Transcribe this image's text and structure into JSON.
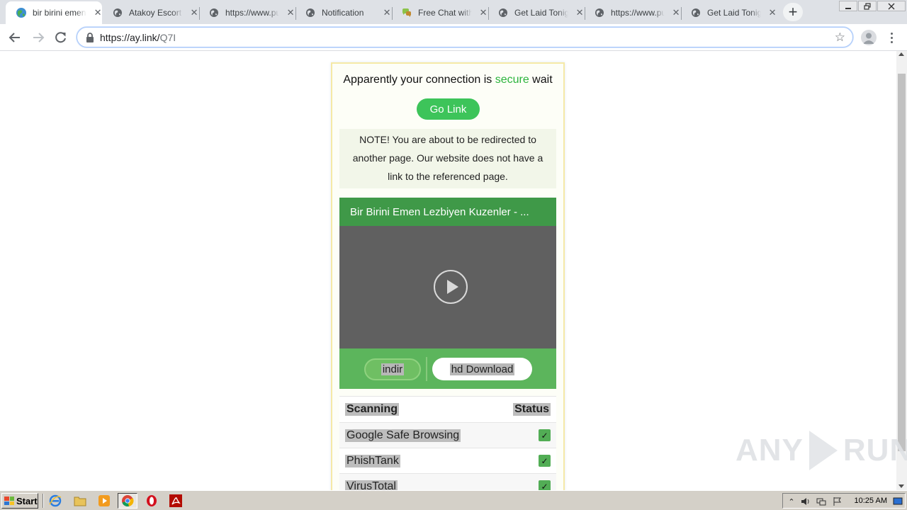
{
  "browser": {
    "tabs": [
      {
        "title": "bir birini emen lezbiyen kuzenler",
        "active": true,
        "icon": "globe-green-icon"
      },
      {
        "title": "Atakoy Escort",
        "active": false,
        "icon": "globe-icon"
      },
      {
        "title": "https://www.pu",
        "active": false,
        "icon": "globe-icon"
      },
      {
        "title": "Notification",
        "active": false,
        "icon": "globe-icon"
      },
      {
        "title": "Free Chat with",
        "active": false,
        "icon": "chat-icon"
      },
      {
        "title": "Get Laid Tonight",
        "active": false,
        "icon": "globe-icon"
      },
      {
        "title": "https://www.pu",
        "active": false,
        "icon": "globe-icon"
      },
      {
        "title": "Get Laid Tonight",
        "active": false,
        "icon": "globe-icon"
      }
    ],
    "tab_close_glyph": "✕",
    "new_tab_glyph": "+",
    "url_host": "https://ay.link/",
    "url_path": "Q7I"
  },
  "page": {
    "connection_prefix": "Apparently your connection is ",
    "connection_secure": "secure",
    "connection_suffix": " wait",
    "go_link_label": "Go Link",
    "note": "NOTE! You are about to be redirected to another page. Our website does not have a link to the referenced page.",
    "video_title": "Bir Birini Emen Lezbiyen Kuzenler - ...",
    "indir_label": "indir",
    "hd_download_label": "hd Download",
    "scan_header": {
      "left": "Scanning",
      "right": "Status"
    },
    "scan_rows": [
      {
        "name": "Google Safe Browsing",
        "status": "✓"
      },
      {
        "name": "PhishTank",
        "status": "✓"
      },
      {
        "name": "VirusTotal",
        "status": "✓"
      }
    ]
  },
  "watermark": {
    "left": "ANY",
    "right": "RUN"
  },
  "taskbar": {
    "start_label": "Start",
    "clock": "10:25 AM"
  },
  "colors": {
    "secure_green": "#2bb43c",
    "go_button": "#3dc45a",
    "video_title_bar": "#3f9948",
    "video_button_bar": "#5cb55c",
    "check_green": "#52ad55"
  }
}
